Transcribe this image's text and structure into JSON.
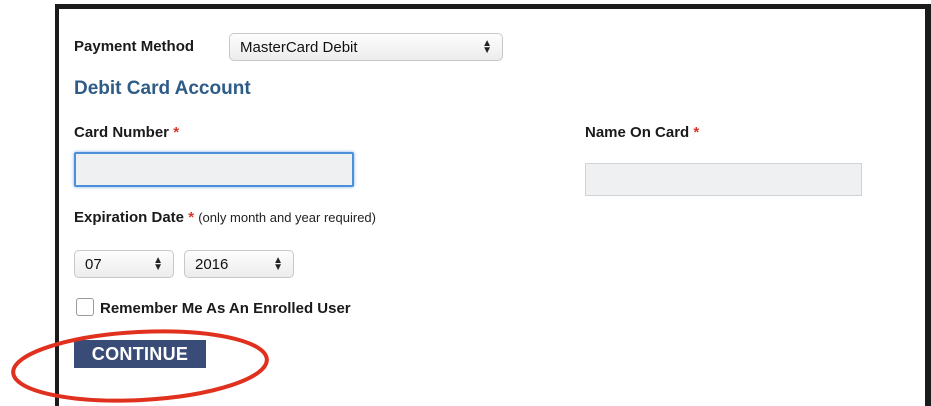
{
  "payment": {
    "method_label": "Payment Method",
    "method_value": "MasterCard Debit"
  },
  "section_title": "Debit Card Account",
  "card_number": {
    "label": "Card Number",
    "required": "*",
    "value": ""
  },
  "name_on_card": {
    "label": "Name On Card",
    "required": "*",
    "value": ""
  },
  "expiration": {
    "label": "Expiration Date",
    "required": "*",
    "note": "(only month and year required)",
    "month": "07",
    "year": "2016"
  },
  "remember": {
    "label": "Remember Me As An Enrolled User",
    "checked": false
  },
  "continue_label": "CONTINUE",
  "colors": {
    "section_title": "#2e5c87",
    "required_mark": "#d9342b",
    "continue_button": "#394c78",
    "annotation_circle": "#e0301e",
    "focus_border": "#4d8fd8"
  }
}
